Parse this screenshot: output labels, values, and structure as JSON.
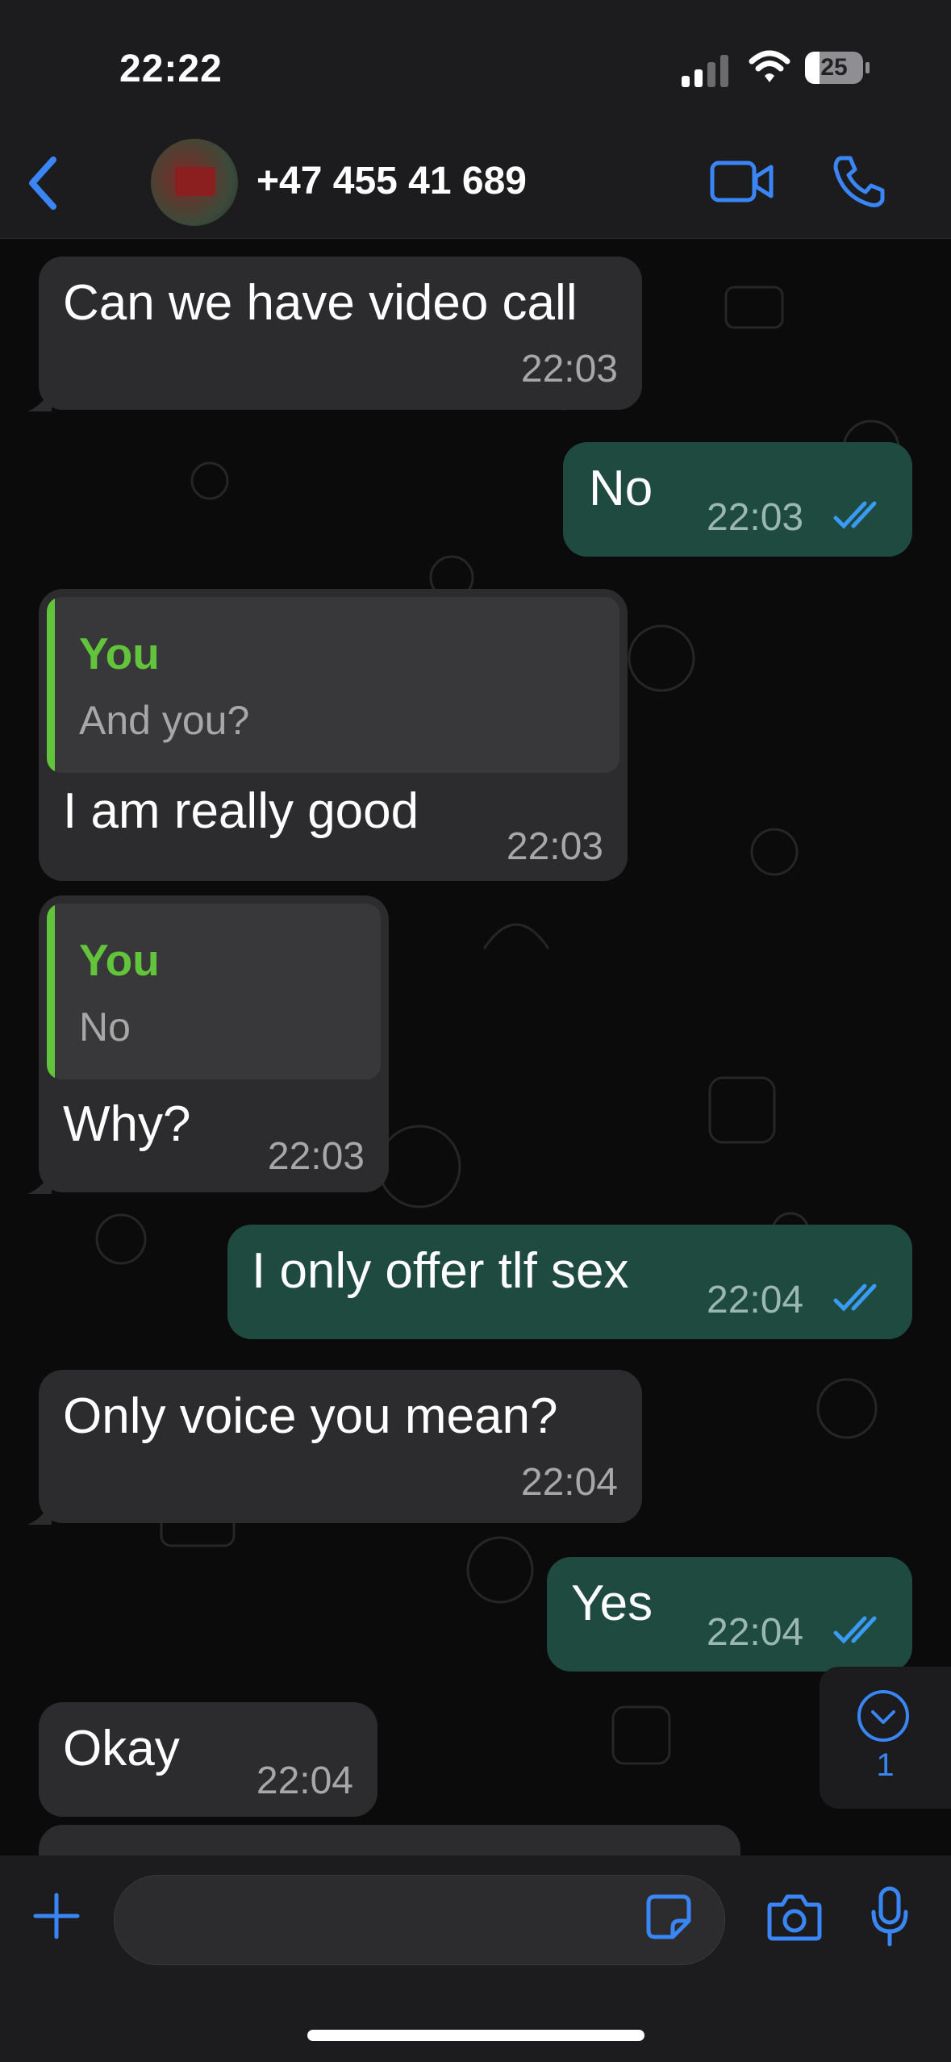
{
  "status_bar": {
    "time": "22:22",
    "battery": "25",
    "battery_fraction": 0.25
  },
  "header": {
    "contact_name": "+47 455 41 689"
  },
  "messages": [
    {
      "dir": "in",
      "text": "Can we have video call",
      "time": "22:03"
    },
    {
      "dir": "out",
      "text": "No",
      "time": "22:03"
    },
    {
      "dir": "in",
      "reply_to_name": "You",
      "reply_to_text": "And you?",
      "text": "I am really good",
      "time": "22:03"
    },
    {
      "dir": "in",
      "reply_to_name": "You",
      "reply_to_text": "No",
      "text": "Why?",
      "time": "22:03"
    },
    {
      "dir": "out",
      "text": "I only offer tlf sex",
      "time": "22:04"
    },
    {
      "dir": "in",
      "text": "Only voice you mean?",
      "time": "22:04"
    },
    {
      "dir": "out",
      "text": "Yes",
      "time": "22:04"
    },
    {
      "dir": "in",
      "text": "Okay",
      "time": "22:04"
    }
  ],
  "scroll_down_badge": "1",
  "colors": {
    "outgoing": "#1e4a3f",
    "incoming": "#2c2c2e",
    "accent": "#3a86f7",
    "reply_name": "#62c43a"
  },
  "icons": [
    "back-chevron-icon",
    "video-call-icon",
    "voice-call-icon",
    "read-receipt-icon",
    "scroll-down-icon",
    "plus-icon",
    "sticker-icon",
    "camera-icon",
    "microphone-icon"
  ]
}
